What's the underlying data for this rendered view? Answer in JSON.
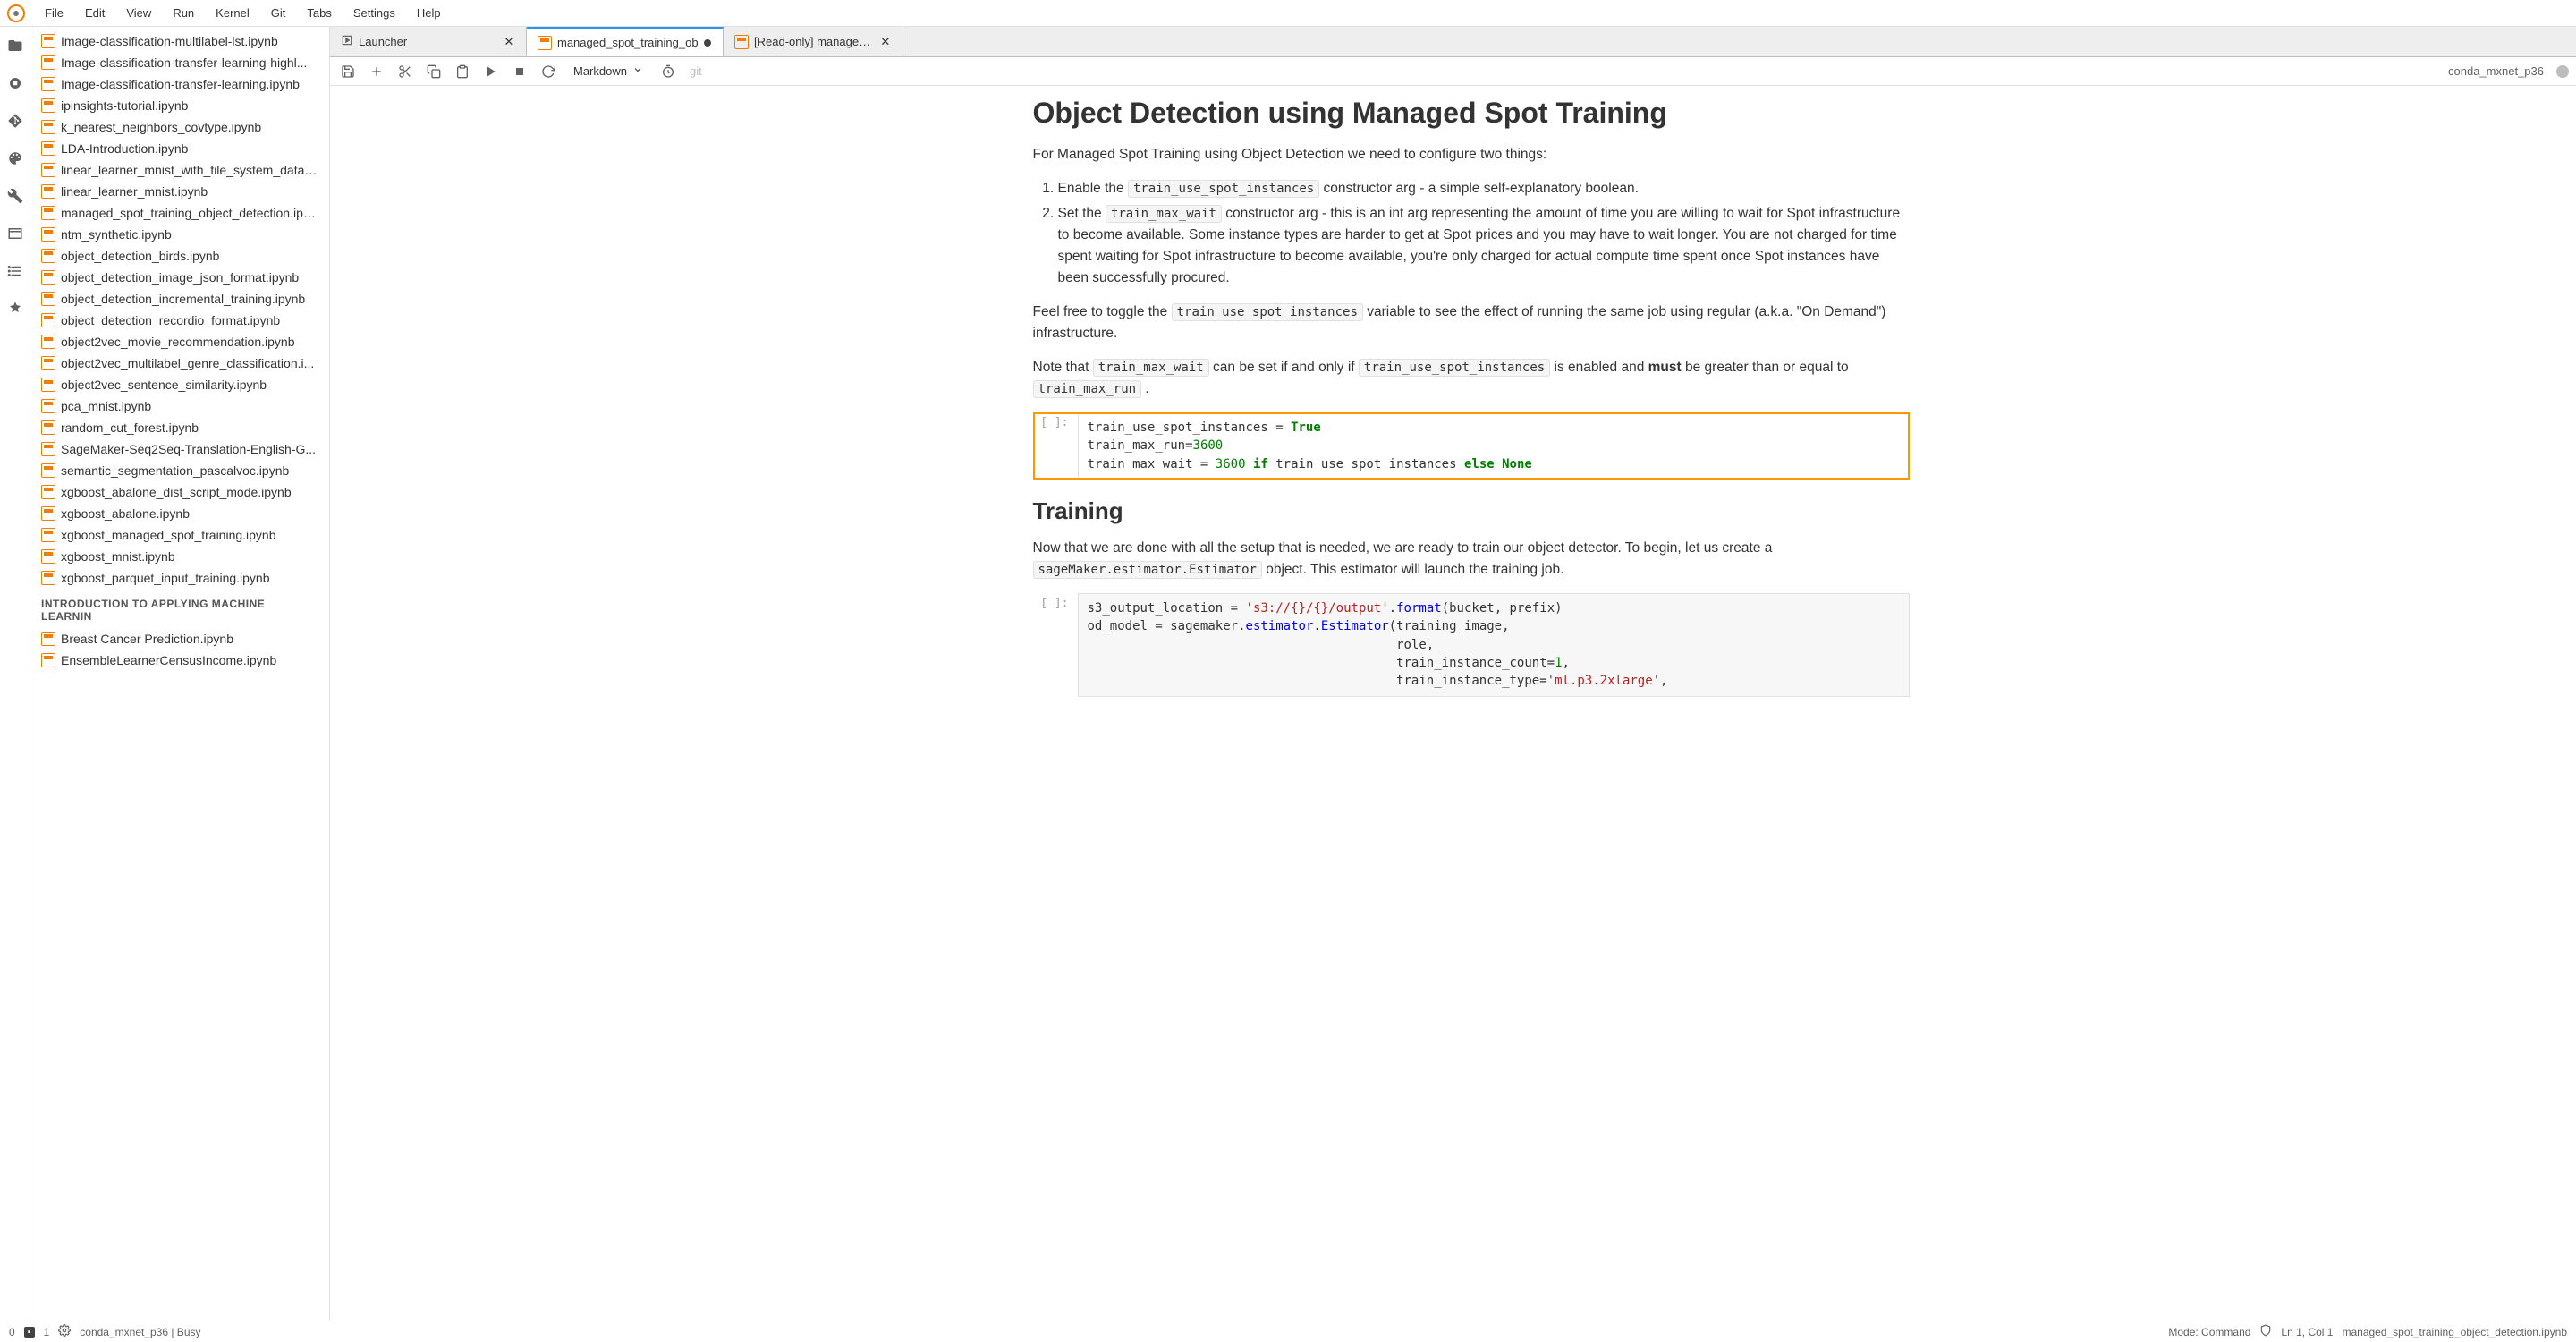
{
  "menu": {
    "items": [
      "File",
      "Edit",
      "View",
      "Run",
      "Kernel",
      "Git",
      "Tabs",
      "Settings",
      "Help"
    ]
  },
  "sidebar": {
    "files": [
      "Image-classification-multilabel-lst.ipynb",
      "Image-classification-transfer-learning-highl...",
      "Image-classification-transfer-learning.ipynb",
      "ipinsights-tutorial.ipynb",
      "k_nearest_neighbors_covtype.ipynb",
      "LDA-Introduction.ipynb",
      "linear_learner_mnist_with_file_system_data_s...",
      "linear_learner_mnist.ipynb",
      "managed_spot_training_object_detection.ipy...",
      "ntm_synthetic.ipynb",
      "object_detection_birds.ipynb",
      "object_detection_image_json_format.ipynb",
      "object_detection_incremental_training.ipynb",
      "object_detection_recordio_format.ipynb",
      "object2vec_movie_recommendation.ipynb",
      "object2vec_multilabel_genre_classification.i...",
      "object2vec_sentence_similarity.ipynb",
      "pca_mnist.ipynb",
      "random_cut_forest.ipynb",
      "SageMaker-Seq2Seq-Translation-English-G...",
      "semantic_segmentation_pascalvoc.ipynb",
      "xgboost_abalone_dist_script_mode.ipynb",
      "xgboost_abalone.ipynb",
      "xgboost_managed_spot_training.ipynb",
      "xgboost_mnist.ipynb",
      "xgboost_parquet_input_training.ipynb"
    ],
    "section_header": "INTRODUCTION TO APPLYING MACHINE LEARNIN",
    "section_files": [
      "Breast Cancer Prediction.ipynb",
      "EnsembleLearnerCensusIncome.ipynb"
    ]
  },
  "tabs": [
    {
      "label": "Launcher",
      "icon": "launcher"
    },
    {
      "label": "managed_spot_training_ob",
      "icon": "nb",
      "dirty": true,
      "active": true
    },
    {
      "label": "[Read-only] managed_spo",
      "icon": "nb"
    }
  ],
  "toolbar": {
    "cell_type": "Markdown",
    "git": "git",
    "kernel": "conda_mxnet_p36"
  },
  "doc": {
    "h1": "Object Detection using Managed Spot Training",
    "p1a": "For Managed Spot Training using Object Detection we need to configure two things:",
    "li1a": "Enable the ",
    "code1": "train_use_spot_instances",
    "li1b": " constructor arg - a simple self-explanatory boolean.",
    "li2a": "Set the ",
    "code2": "train_max_wait",
    "li2b": " constructor arg - this is an int arg representing the amount of time you are willing to wait for Spot infrastructure to become available. Some instance types are harder to get at Spot prices and you may have to wait longer. You are not charged for time spent waiting for Spot infrastructure to become available, you're only charged for actual compute time spent once Spot instances have been successfully procured.",
    "p2a": "Feel free to toggle the ",
    "p2b": " variable to see the effect of running the same job using regular (a.k.a. \"On Demand\") infrastructure.",
    "p3a": "Note that ",
    "p3b": " can be set if and only if ",
    "p3c": " is enabled and ",
    "p3d": "must",
    "p3e": " be greater than or equal to ",
    "code5": "train_max_run",
    "p3f": " .",
    "prompt": "[ ]:",
    "h2": "Training",
    "p4a": "Now that we are done with all the setup that is needed, we are ready to train our object detector. To begin, let us create a ",
    "code6": "sageMaker.estimator.Estimator",
    "p4b": " object. This estimator will launch the training job."
  },
  "status": {
    "left_num": "0",
    "left_badge_icon": "▪",
    "left_badge_num": "1",
    "env": "conda_mxnet_p36 | Busy",
    "mode": "Mode: Command",
    "pos": "Ln 1, Col 1",
    "file": "managed_spot_training_object_detection.ipynb"
  }
}
